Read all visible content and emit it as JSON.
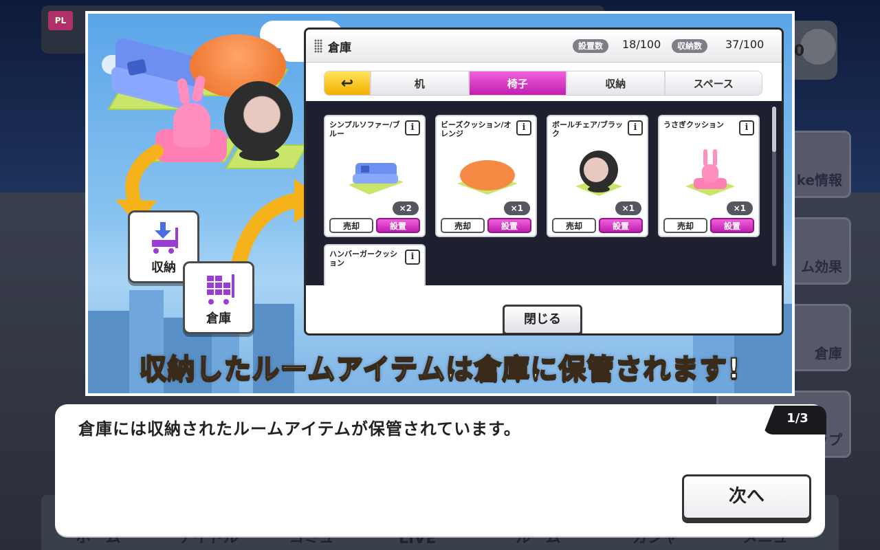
{
  "background": {
    "play_tag": "PL",
    "coin_value": "0",
    "side_buttons": [
      "ke情報",
      "ム効果",
      "倉庫",
      "ップ"
    ],
    "bottom_nav": [
      "ホーム",
      "アイドル",
      "コミュ",
      "LIVE",
      "ルーム",
      "ガシャ",
      "メニュー"
    ]
  },
  "inventory": {
    "title": "倉庫",
    "placed_label": "設置数",
    "placed_value": "18/100",
    "stored_label": "収納数",
    "stored_value": "37/100",
    "tabs": [
      {
        "label": "↩",
        "icon": "back-arrow-icon"
      },
      {
        "label": "机"
      },
      {
        "label": "椅子"
      },
      {
        "label": "収納"
      },
      {
        "label": "スペース"
      }
    ],
    "active_tab": "椅子",
    "items": [
      {
        "name": "シンプルソファー/ブルー",
        "qty": "×2",
        "sell": "売却",
        "place": "設置"
      },
      {
        "name": "ビーズクッション/オレンジ",
        "qty": "×1",
        "sell": "売却",
        "place": "設置"
      },
      {
        "name": "ボールチェア/ブラック",
        "qty": "×1",
        "sell": "売却",
        "place": "設置"
      },
      {
        "name": "うさぎクッション",
        "qty": "×1",
        "sell": "売却",
        "place": "設置"
      },
      {
        "name": "ハンバーガークッション"
      }
    ],
    "info_label": "i",
    "close_label": "閉じる"
  },
  "illustration": {
    "store_label": "収納",
    "warehouse_label": "倉庫"
  },
  "caption": {
    "before": "収納したルームアイテムは",
    "highlight": "倉庫",
    "after": "に保管されます!"
  },
  "dialog": {
    "text": "倉庫には収納されたルームアイテムが保管されています。",
    "page": "1/3",
    "next_label": "次へ"
  }
}
